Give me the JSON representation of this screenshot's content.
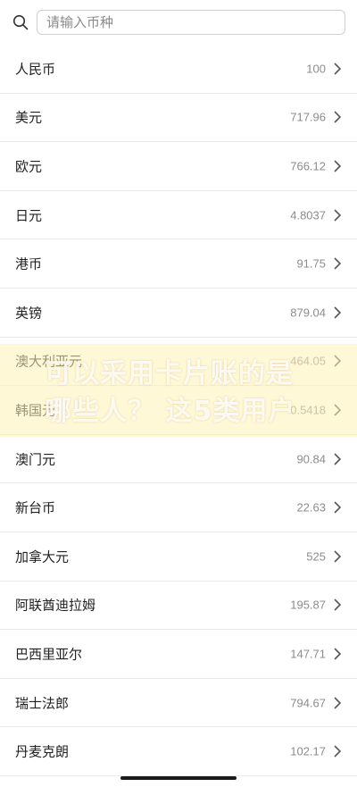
{
  "search": {
    "placeholder": "请输入币种",
    "value": ""
  },
  "currencies": [
    {
      "name": "人民币",
      "rate": "100"
    },
    {
      "name": "美元",
      "rate": "717.96"
    },
    {
      "name": "欧元",
      "rate": "766.12"
    },
    {
      "name": "日元",
      "rate": "4.8037"
    },
    {
      "name": "港币",
      "rate": "91.75"
    },
    {
      "name": "英镑",
      "rate": "879.04"
    },
    {
      "name": "澳大利亚元",
      "rate": "464.05"
    },
    {
      "name": "韩国元",
      "rate": "0.5418"
    },
    {
      "name": "澳门元",
      "rate": "90.84"
    },
    {
      "name": "新台币",
      "rate": "22.63"
    },
    {
      "name": "加拿大元",
      "rate": "525"
    },
    {
      "name": "阿联酋迪拉姆",
      "rate": "195.87"
    },
    {
      "name": "巴西里亚尔",
      "rate": "147.71"
    },
    {
      "name": "瑞士法郎",
      "rate": "794.67"
    },
    {
      "name": "丹麦克朗",
      "rate": "102.17"
    }
  ],
  "watermark": {
    "line1": "可以采用卡片账的是",
    "line2": "哪些人？ 这5类用户"
  },
  "colors": {
    "watermark_band": "#fff3b4",
    "row_divider": "#e9e9e9",
    "rate_text": "#8c8c8c"
  }
}
